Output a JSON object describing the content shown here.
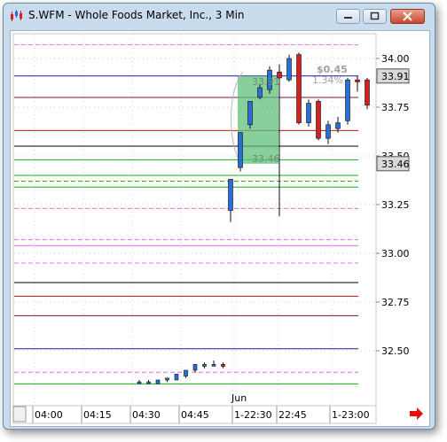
{
  "window": {
    "title": "S.WFM - Whole Foods Market, Inc., 3 Min"
  },
  "price_axis": {
    "ticks": [
      "34.00",
      "33.75",
      "33.50",
      "33.25",
      "33.00",
      "32.75",
      "32.50"
    ],
    "marker_high": "33.91",
    "marker_low": "33.46"
  },
  "time_axis": {
    "ticks": [
      "04:00",
      "04:15",
      "04:30",
      "04:45",
      "1-22:30",
      "22:45",
      "1-23:00"
    ],
    "month_label": "Jun"
  },
  "annotations": {
    "zone_high": "33.91",
    "zone_low": "33.46",
    "change": "$0.45",
    "change_pct": "1.34%"
  },
  "colors": {
    "up_candle": "#2a6fd6",
    "down_candle": "#d42020",
    "zone_fill": "#5fbf7a",
    "nav_arrow": "#e01010"
  },
  "chart_data": {
    "type": "candlestick",
    "ylim": [
      32.3,
      34.08
    ],
    "levels": [
      {
        "price": 34.07,
        "color": "#e56fe5",
        "style": "dashed"
      },
      {
        "price": 33.91,
        "color": "#1a1aa6",
        "style": "solid"
      },
      {
        "price": 33.8,
        "color": "#7a1050",
        "style": "solid"
      },
      {
        "price": 33.63,
        "color": "#c01818",
        "style": "solid"
      },
      {
        "price": 33.55,
        "color": "#000000",
        "style": "solid"
      },
      {
        "price": 33.48,
        "color": "#18a818",
        "style": "solid"
      },
      {
        "price": 33.4,
        "color": "#18a818",
        "style": "solid"
      },
      {
        "price": 33.37,
        "color": "#18a818",
        "style": "dashed"
      },
      {
        "price": 33.34,
        "color": "#18a818",
        "style": "solid"
      },
      {
        "price": 33.23,
        "color": "#e56fe5",
        "style": "dashed"
      },
      {
        "price": 33.07,
        "color": "#e56fe5",
        "style": "dashed"
      },
      {
        "price": 33.04,
        "color": "#e56fe5",
        "style": "solid"
      },
      {
        "price": 32.95,
        "color": "#e56fe5",
        "style": "dashed"
      },
      {
        "price": 32.85,
        "color": "#000000",
        "style": "solid"
      },
      {
        "price": 32.78,
        "color": "#a81818",
        "style": "solid"
      },
      {
        "price": 32.68,
        "color": "#7a1050",
        "style": "solid"
      },
      {
        "price": 32.51,
        "color": "#1a1aa6",
        "style": "solid"
      },
      {
        "price": 32.39,
        "color": "#e56fe5",
        "style": "dashed"
      },
      {
        "price": 32.33,
        "color": "#18a818",
        "style": "solid"
      }
    ],
    "candles_main": [
      {
        "o": 33.22,
        "h": 33.38,
        "l": 33.16,
        "c": 33.38
      },
      {
        "o": 33.44,
        "h": 33.62,
        "l": 33.42,
        "c": 33.62
      },
      {
        "o": 33.66,
        "h": 33.78,
        "l": 33.64,
        "c": 33.78
      },
      {
        "o": 33.8,
        "h": 33.87,
        "l": 33.79,
        "c": 33.85
      },
      {
        "o": 33.84,
        "h": 33.96,
        "l": 33.82,
        "c": 33.94
      },
      {
        "o": 33.93,
        "h": 33.97,
        "l": 33.19,
        "c": 33.9
      },
      {
        "o": 33.89,
        "h": 34.02,
        "l": 33.88,
        "c": 34.0
      },
      {
        "o": 34.02,
        "h": 34.03,
        "l": 33.66,
        "c": 33.67
      },
      {
        "o": 33.67,
        "h": 33.79,
        "l": 33.65,
        "c": 33.77
      },
      {
        "o": 33.78,
        "h": 33.79,
        "l": 33.58,
        "c": 33.59
      },
      {
        "o": 33.59,
        "h": 33.68,
        "l": 33.56,
        "c": 33.66
      },
      {
        "o": 33.64,
        "h": 33.7,
        "l": 33.62,
        "c": 33.67
      },
      {
        "o": 33.68,
        "h": 33.9,
        "l": 33.66,
        "c": 33.89
      },
      {
        "o": 33.89,
        "h": 33.91,
        "l": 33.83,
        "c": 33.88
      },
      {
        "o": 33.89,
        "h": 33.9,
        "l": 33.74,
        "c": 33.76
      }
    ],
    "candles_early": [
      {
        "o": 32.34,
        "h": 32.35,
        "l": 32.33,
        "c": 32.34
      },
      {
        "o": 32.34,
        "h": 32.35,
        "l": 32.33,
        "c": 32.34
      },
      {
        "o": 32.33,
        "h": 32.35,
        "l": 32.33,
        "c": 32.35
      },
      {
        "o": 32.35,
        "h": 32.36,
        "l": 32.34,
        "c": 32.36
      },
      {
        "o": 32.35,
        "h": 32.38,
        "l": 32.35,
        "c": 32.38
      },
      {
        "o": 32.37,
        "h": 32.4,
        "l": 32.36,
        "c": 32.4
      },
      {
        "o": 32.4,
        "h": 32.43,
        "l": 32.39,
        "c": 32.43
      },
      {
        "o": 32.42,
        "h": 32.44,
        "l": 32.41,
        "c": 32.43
      },
      {
        "o": 32.43,
        "h": 32.45,
        "l": 32.42,
        "c": 32.43
      },
      {
        "o": 32.43,
        "h": 32.44,
        "l": 32.41,
        "c": 32.42
      }
    ]
  }
}
